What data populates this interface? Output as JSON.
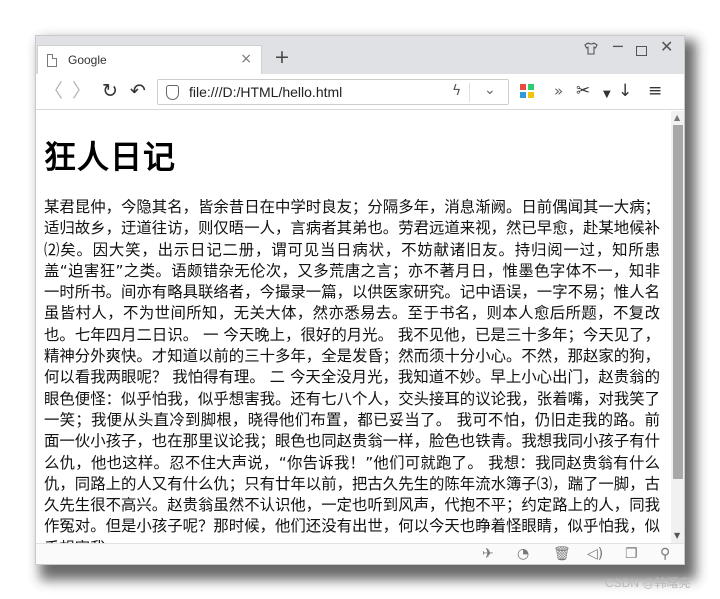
{
  "browser": {
    "tab": {
      "title": "Google"
    },
    "address_bar": {
      "url": "file:///D:/HTML/hello.html"
    }
  },
  "page": {
    "heading": "狂人日记",
    "body_text": "某君昆仲，今隐其名，皆余昔日在中学时良友；分隔多年，消息渐阙。日前偶闻其一大病；适归故乡，迂道往访，则仅晤一人，言病者其弟也。劳君远道来视，然已早愈，赴某地候补⑵矣。因大笑，出示日记二册，谓可见当日病状，不妨献诸旧友。持归阅一过，知所患盖“迫害狂”之类。语颇错杂无伦次，又多荒唐之言；亦不著月日，惟墨色字体不一，知非一时所书。间亦有略具联络者，今撮录一篇，以供医家研究。记中语误，一字不易；惟人名虽皆村人，不为世间所知，无关大体，然亦悉易去。至于书名，则本人愈后所题，不复改也。七年四月二日识。 一 今天晚上，很好的月光。 我不见他，已是三十多年；今天见了，精神分外爽快。才知道以前的三十多年，全是发昏；然而须十分小心。不然，那赵家的狗，何以看我两眼呢？ 我怕得有理。 二 今天全没月光，我知道不妙。早上小心出门，赵贵翁的眼色便怪：似乎怕我，似乎想害我。还有七八个人，交头接耳的议论我，张着嘴，对我笑了一笑；我便从头直冷到脚根，晓得他们布置，都已妥当了。 我可不怕，仍旧走我的路。前面一伙小孩子，也在那里议论我；眼色也同赵贵翁一样，脸色也铁青。我想我同小孩子有什么仇，他也这样。忍不住大声说，“你告诉我！”他们可就跑了。 我想：我同赵贵翁有什么仇，同路上的人又有什么仇；只有廿年以前，把古久先生的陈年流水簿子⑶，踹了一脚，古久先生很不高兴。赵贵翁虽然不认识他，一定也听到风声，代抱不平；约定路上的人，同我作冤对。但是小孩子呢？那时候，他们还没有出世，何以今天也睁着怪眼睛，似乎怕我，似乎想害我。"
  },
  "watermark": "CSDN @韩曙亮",
  "colors": {
    "titlebar": "#dfe1e5",
    "tab_bg": "#ffffff",
    "scroll_thumb": "#a8a8a8",
    "text": "#111111"
  }
}
